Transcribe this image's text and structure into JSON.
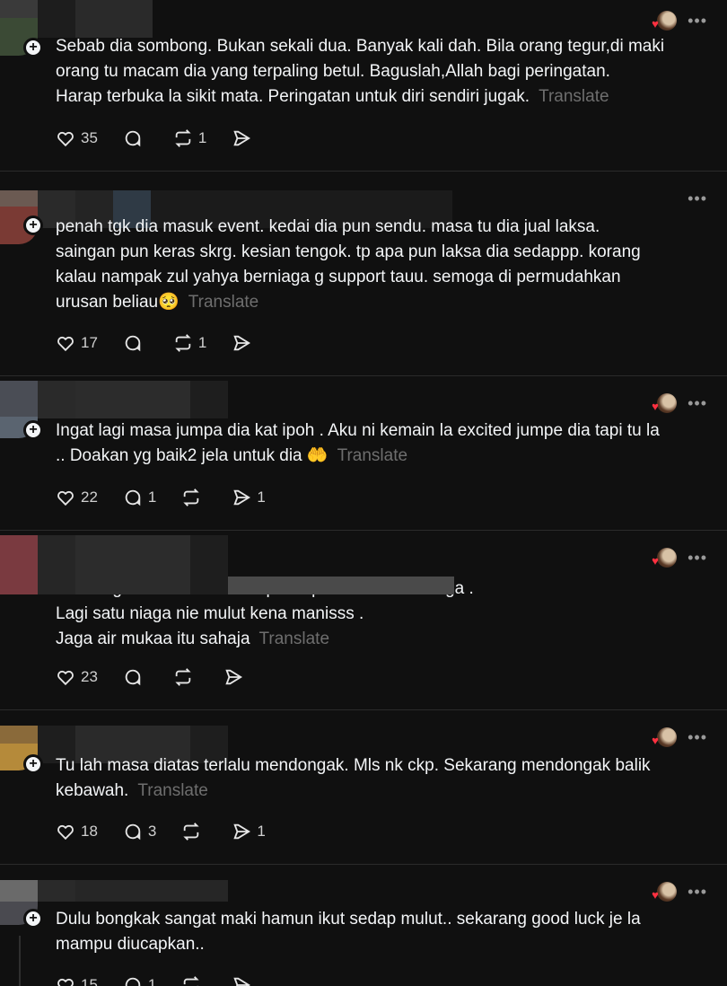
{
  "posts": [
    {
      "text": "Sebab dia sombong. Bukan sekali dua. Banyak kali dah. Bila orang tegur,di maki\norang tu macam dia yang terpaling betul. Baguslah,Allah bagi peringatan.\nHarap terbuka la sikit mata. Peringatan untuk diri sendiri jugak.",
      "translate": "Translate",
      "likes": "35",
      "replies": "",
      "reposts": "1",
      "shares": ""
    },
    {
      "text": "penah tgk dia masuk event. kedai dia pun sendu. masa tu dia jual laksa.\nsaingan pun keras skrg. kesian tengok. tp apa pun laksa dia sedappp. korang\nkalau nampak zul yahya berniaga g support tauu. semoga di permudahkan\nurusan beliau🥺",
      "translate": "Translate",
      "likes": "17",
      "replies": "",
      "reposts": "1",
      "shares": ""
    },
    {
      "text": "Ingat lagi masa jumpa dia kat ipoh . Aku ni kemain la excited jumpe dia tapi tu la\n.. Doakan yg baik2 jela untuk dia 🤲",
      "translate": "Translate",
      "likes": "22",
      "replies": "1",
      "reposts": "",
      "shares": "1"
    },
    {
      "text": "Kita niaga kita kena neutral pasal politik bila kita niaga .\nLagi satu niaga nie mulut kena manisss .\nJaga air mukaa itu sahaja",
      "translate": "Translate",
      "likes": "23",
      "replies": "",
      "reposts": "",
      "shares": ""
    },
    {
      "text": "Tu lah masa diatas terlalu mendongak. Mls nk ckp. Sekarang mendongak balik\nkebawah.",
      "translate": "Translate",
      "likes": "18",
      "replies": "3",
      "reposts": "",
      "shares": "1"
    },
    {
      "text": "Dulu bongkak sangat maki hamun ikut sedap mulut.. sekarang good luck je la\nmampu diucapkan..",
      "translate": "",
      "likes": "15",
      "replies": "1",
      "reposts": "",
      "shares": ""
    }
  ],
  "icons": {
    "like": "heart-icon",
    "reply": "comment-icon",
    "repost": "repost-icon",
    "share": "send-icon",
    "more": "more-icon",
    "follow": "plus-icon"
  },
  "colors": {
    "background": "#101010",
    "text": "#f3f5f7",
    "muted": "#6e6e6e",
    "heart_red": "#ff3040"
  }
}
